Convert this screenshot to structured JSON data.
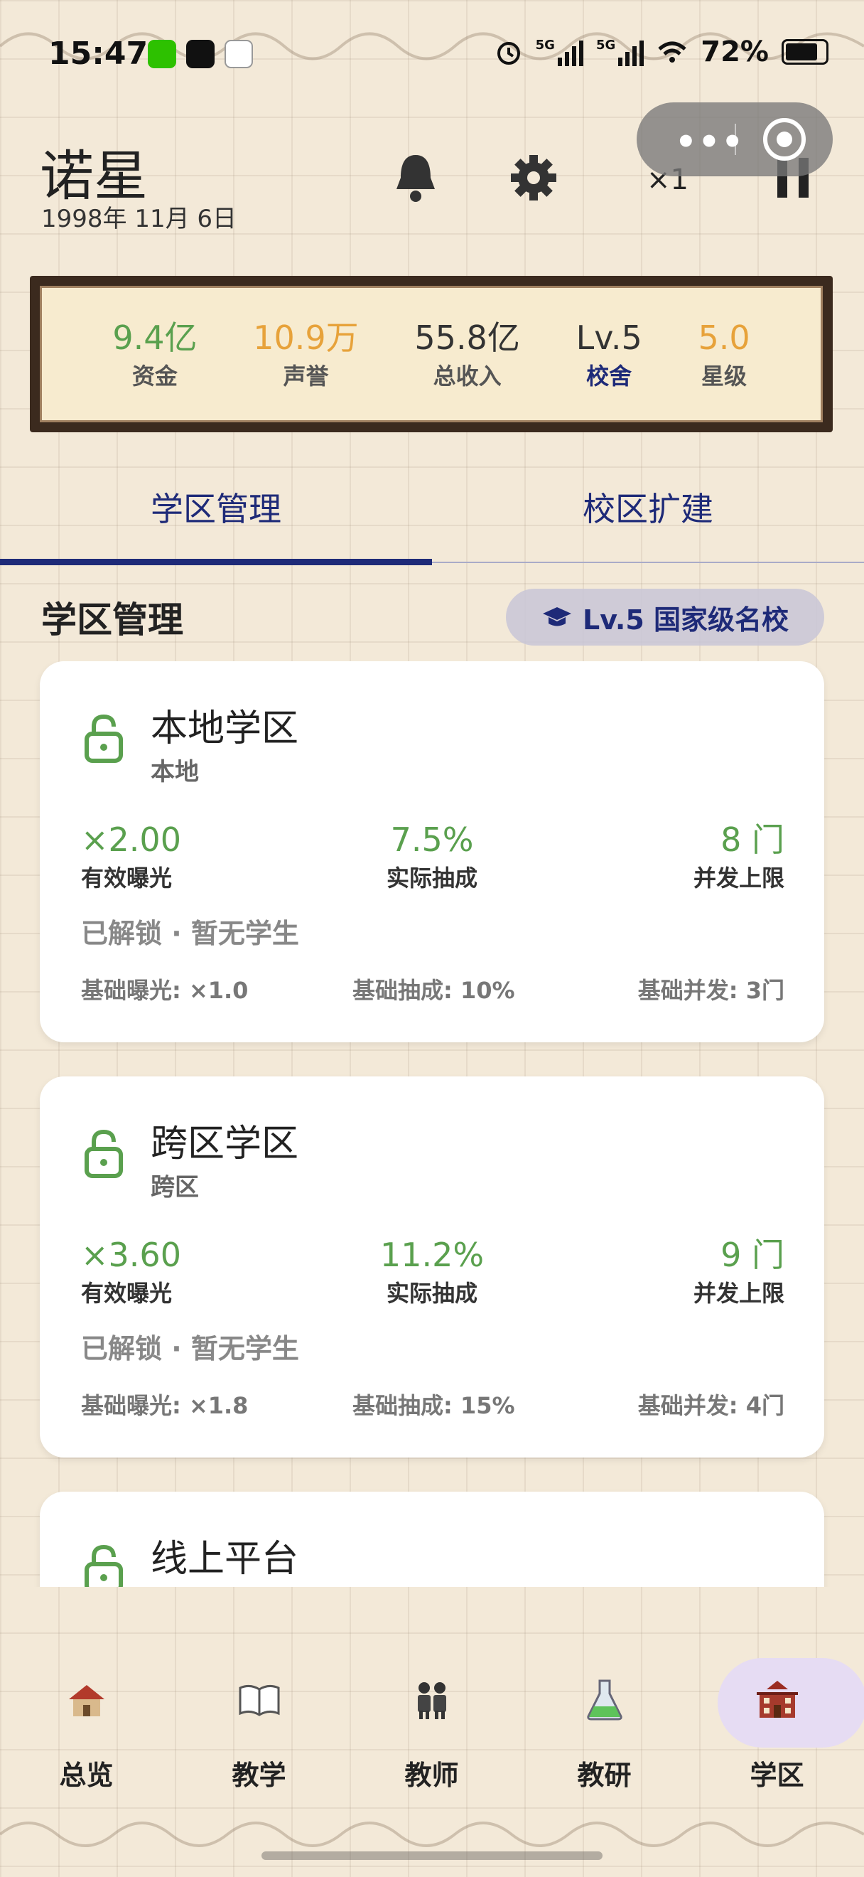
{
  "status_bar": {
    "time": "15:47",
    "network_1": "5G",
    "network_2": "5G",
    "battery": "72%"
  },
  "header": {
    "name": "诺星",
    "date": "1998年 11月 6日",
    "speed": "×1"
  },
  "stats": [
    {
      "value": "9.4亿",
      "label": "资金",
      "value_color": "#5aa04e",
      "label_color": "#555555"
    },
    {
      "value": "10.9万",
      "label": "声誉",
      "value_color": "#e7a23a",
      "label_color": "#555555"
    },
    {
      "value": "55.8亿",
      "label": "总收入",
      "value_color": "#333333",
      "label_color": "#555555"
    },
    {
      "value": "Lv.5",
      "label": "校舍",
      "value_color": "#333333",
      "label_color": "#1e2a78"
    },
    {
      "value": "5.0",
      "label": "星级",
      "value_color": "#e7a23a",
      "label_color": "#555555"
    }
  ],
  "tabs": [
    "学区管理",
    "校区扩建"
  ],
  "active_tab": 0,
  "section": {
    "title": "学区管理",
    "badge": "Lv.5 国家级名校"
  },
  "districts": [
    {
      "title": "本地学区",
      "subtitle": "本地",
      "exposure": "×2.00",
      "exposure_label": "有效曝光",
      "commission": "7.5%",
      "commission_label": "实际抽成",
      "concurrency": "8 门",
      "concurrency_label": "并发上限",
      "status": "已解锁 · 暂无学生",
      "base_exposure": "基础曝光: ×1.0",
      "base_commission": "基础抽成: 10%",
      "base_concurrency": "基础并发: 3门"
    },
    {
      "title": "跨区学区",
      "subtitle": "跨区",
      "exposure": "×3.60",
      "exposure_label": "有效曝光",
      "commission": "11.2%",
      "commission_label": "实际抽成",
      "concurrency": "9 门",
      "concurrency_label": "并发上限",
      "status": "已解锁 · 暂无学生",
      "base_exposure": "基础曝光: ×1.8",
      "base_commission": "基础抽成: 15%",
      "base_concurrency": "基础并发: 4门"
    },
    {
      "title": "线上平台"
    }
  ],
  "nav": [
    {
      "label": "总览",
      "icon": "school-house-icon"
    },
    {
      "label": "教学",
      "icon": "book-icon"
    },
    {
      "label": "教师",
      "icon": "teachers-icon"
    },
    {
      "label": "教研",
      "icon": "flask-icon"
    },
    {
      "label": "学区",
      "icon": "school-building-icon"
    }
  ],
  "active_nav": 4,
  "colors": {
    "accent": "#1e2a78",
    "positive": "#5aa04e",
    "warning": "#e7a23a",
    "background": "#f3e9d8"
  }
}
